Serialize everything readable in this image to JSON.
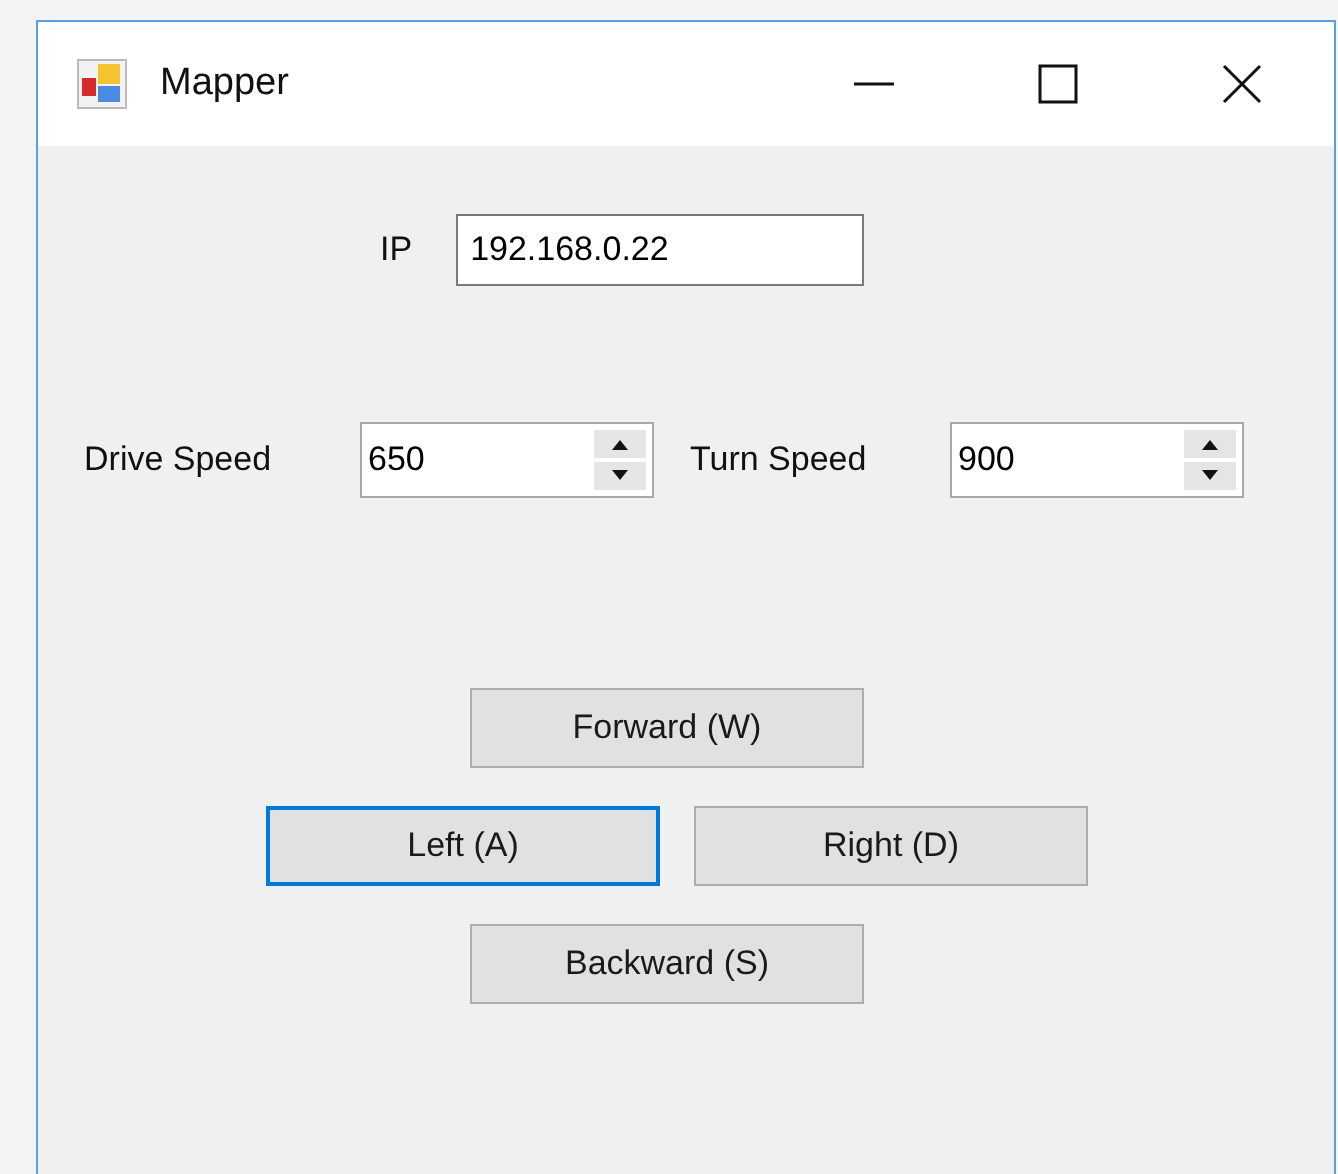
{
  "window": {
    "title": "Mapper"
  },
  "ip": {
    "label": "IP",
    "value": "192.168.0.22"
  },
  "speeds": [
    {
      "label": "Drive Speed",
      "value": "650"
    },
    {
      "label": "Turn Speed",
      "value": "900"
    }
  ],
  "buttons": [
    {
      "label": "Forward (W)",
      "focused": false
    },
    {
      "label": "Left (A)",
      "focused": true
    },
    {
      "label": "Right (D)",
      "focused": false
    },
    {
      "label": "Backward (S)",
      "focused": false
    }
  ]
}
